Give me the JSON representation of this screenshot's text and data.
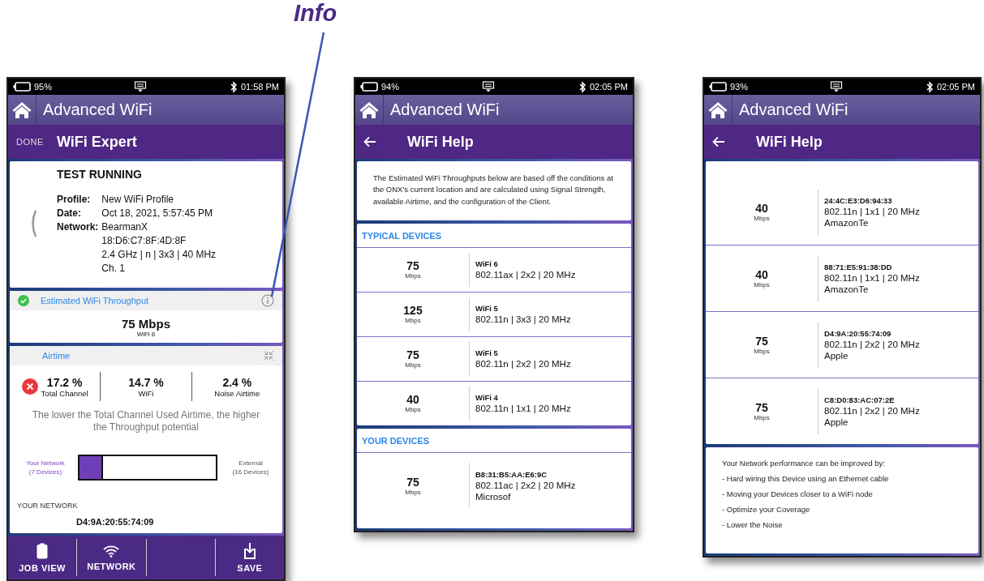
{
  "annotation": {
    "label": "Info"
  },
  "screens": [
    {
      "kind": "expert",
      "status": {
        "battery": "95%",
        "time": "01:58 PM"
      },
      "app_title": "Advanced WiFi",
      "header": {
        "action": "DONE",
        "title": "WiFi Expert"
      },
      "test": {
        "status": "TEST RUNNING",
        "fields": [
          {
            "label": "Profile:",
            "lines": [
              "New WiFi Profile"
            ]
          },
          {
            "label": "Date:",
            "lines": [
              "Oct 18, 2021, 5:57:45 PM"
            ]
          },
          {
            "label": "Network:",
            "lines": [
              "BearmanX",
              "18:D6:C7:8F:4D:8F",
              "2.4 GHz | n | 3x3 | 40 MHz",
              "Ch. 1"
            ]
          }
        ]
      },
      "throughput": {
        "title": "Estimated WiFi Throughput",
        "value": "75 Mbps",
        "standard": "WiFi 6"
      },
      "airtime": {
        "title": "Airtime",
        "stats": [
          {
            "value": "17.2 %",
            "label": "Total Channel",
            "alert": true
          },
          {
            "value": "14.7 %",
            "label": "WiFi",
            "alert": false
          },
          {
            "value": "2.4 %",
            "label": "Noise Airtime",
            "alert": false
          }
        ],
        "note": "The lower the Total Channel Used Airtime, the higher the Throughput potential",
        "bar": {
          "left_lines": [
            "Your Network",
            "(7 Devices)"
          ],
          "right_lines": [
            "External",
            "(16 Devices)"
          ],
          "level": 0.16
        },
        "section": "YOUR NETWORK",
        "device": "D4:9A:20:55:74:09"
      },
      "nav": [
        {
          "kind": "button",
          "label": "JOB VIEW"
        },
        {
          "kind": "button",
          "label": "NETWORK"
        },
        {
          "kind": "empty"
        },
        {
          "kind": "button",
          "label": "SAVE"
        }
      ]
    },
    {
      "kind": "help",
      "status": {
        "battery": "94%",
        "time": "02:05 PM"
      },
      "app_title": "Advanced WiFi",
      "header": {
        "title": "WiFi Help"
      },
      "intro": "The Estimated WiFi Throughputs below are based off the conditions at the ONX's current location and are calculated using Signal Strength, available Airtime, and the configuration of the Client.",
      "sections": [
        {
          "title": "TYPICAL DEVICES",
          "rows": [
            {
              "speed": "75",
              "unit": "Mbps",
              "name": "WiFi 6",
              "spec": "802.11ax | 2x2 | 20 MHz"
            },
            {
              "speed": "125",
              "unit": "Mbps",
              "name": "WiFi 5",
              "spec": "802.11n | 3x3 | 20 MHz"
            },
            {
              "speed": "75",
              "unit": "Mbps",
              "name": "WiFi 5",
              "spec": "802.11n | 2x2 | 20 MHz"
            },
            {
              "speed": "40",
              "unit": "Mbps",
              "name": "WiFi 4",
              "spec": "802.11n | 1x1 | 20 MHz"
            }
          ]
        },
        {
          "title": "YOUR DEVICES",
          "rows": [
            {
              "speed": "75",
              "unit": "Mbps",
              "name": "B8:31:B5:AA:E6:9C",
              "spec": "802.11ac | 2x2 | 20 MHz",
              "vendor": "Microsof"
            }
          ]
        }
      ]
    },
    {
      "kind": "help",
      "status": {
        "battery": "93%",
        "time": "02:05 PM"
      },
      "app_title": "Advanced WiFi",
      "header": {
        "title": "WiFi Help"
      },
      "sections": [
        {
          "rows": [
            {
              "speed": "40",
              "unit": "Mbps",
              "name": "24:4C:E3:D6:94:33",
              "spec": "802.11n | 1x1 | 20 MHz",
              "vendor": "AmazonTe"
            },
            {
              "speed": "40",
              "unit": "Mbps",
              "name": "88:71:E5:91:38:DD",
              "spec": "802.11n | 1x1 | 20 MHz",
              "vendor": "AmazonTe"
            },
            {
              "speed": "75",
              "unit": "Mbps",
              "name": "D4:9A:20:55:74:09",
              "spec": "802.11n | 2x2 | 20 MHz",
              "vendor": "Apple"
            },
            {
              "speed": "75",
              "unit": "Mbps",
              "name": "C8:D0:83:AC:07:2E",
              "spec": "802.11n | 2x2 | 20 MHz",
              "vendor": "Apple"
            }
          ]
        }
      ],
      "tips": [
        "Your Network performance can be improved by:",
        "- Hard wiring this Device using an Ethernet cable",
        "- Moving your Devices closer to a WiFi node",
        "- Optimize your Coverage",
        "- Lower the Noise"
      ]
    }
  ]
}
